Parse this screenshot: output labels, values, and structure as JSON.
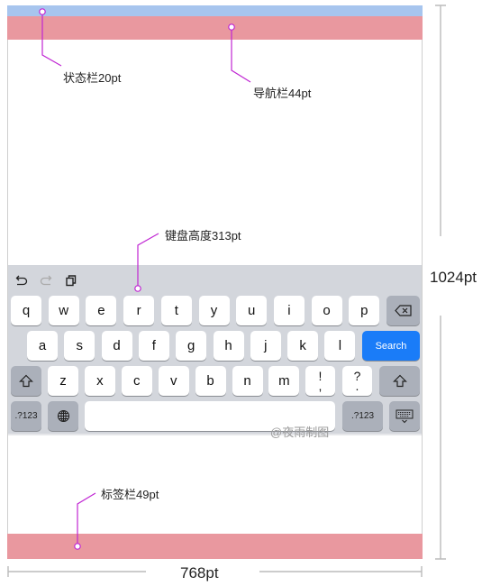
{
  "annotations": {
    "status_bar": "状态栏20pt",
    "nav_bar": "导航栏44pt",
    "keyboard": "键盘高度313pt",
    "tab_bar": "标签栏49pt",
    "height": "1024pt",
    "width": "768pt"
  },
  "colors": {
    "status_bar": "#a7c5ee",
    "nav_bar": "#e9989f",
    "tab_bar": "#e9989f",
    "keyboard_bg": "#d3d6dc",
    "search_key": "#1a7cf8",
    "annotation_line": "#c026d3"
  },
  "keyboard": {
    "toolbar_icons": [
      "undo-icon",
      "redo-icon",
      "paste-icon"
    ],
    "row1": [
      "q",
      "w",
      "e",
      "r",
      "t",
      "y",
      "u",
      "i",
      "o",
      "p"
    ],
    "row2": [
      "a",
      "s",
      "d",
      "f",
      "g",
      "h",
      "j",
      "k",
      "l"
    ],
    "row3": [
      "z",
      "x",
      "c",
      "v",
      "b",
      "n",
      "m"
    ],
    "row3_punct": [
      {
        "top": "!",
        "bottom": ","
      },
      {
        "top": "?",
        "bottom": "."
      }
    ],
    "search_label": "Search",
    "numbers_label": ".?123"
  },
  "watermark": "@夜雨制图"
}
